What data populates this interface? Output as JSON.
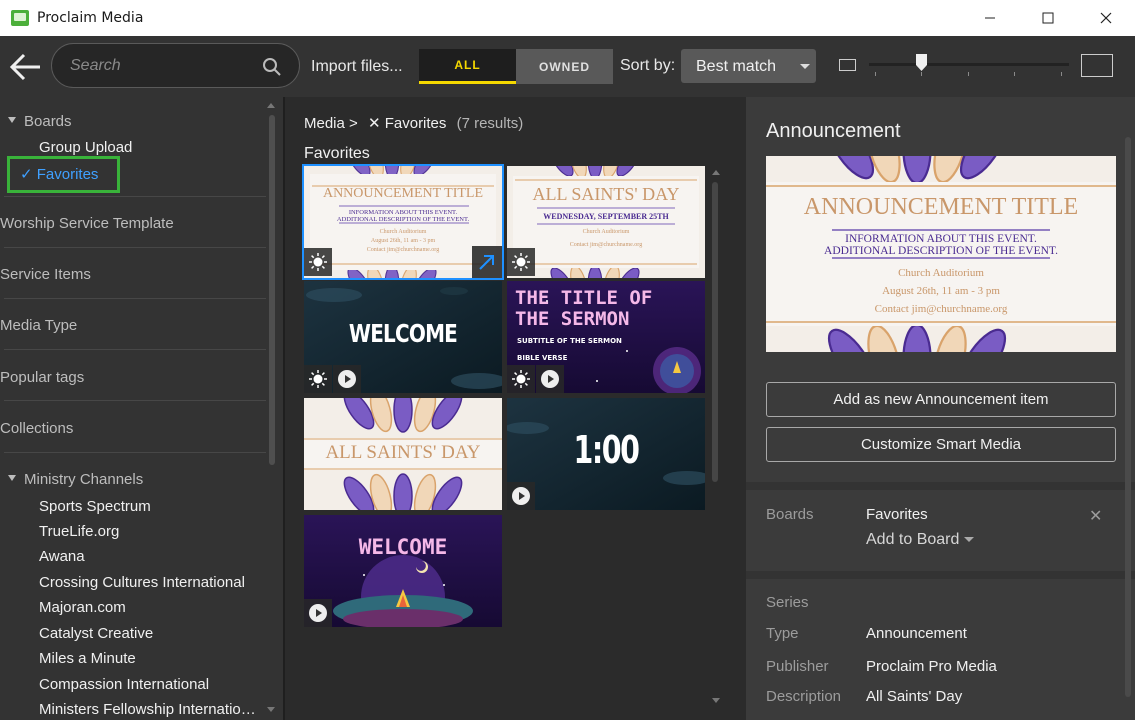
{
  "window": {
    "title": "Proclaim Media",
    "minimize": "—",
    "maximize": "☐",
    "close": "✕"
  },
  "toolbar": {
    "search_placeholder": "Search",
    "import_label": "Import files...",
    "filter_all": "ALL",
    "filter_owned": "OWNED",
    "sort_label": "Sort by:",
    "sort_value": "Best match",
    "zoom_level": 0.26
  },
  "sidebar": {
    "sections": [
      {
        "label": "Boards",
        "expanded": true
      },
      {
        "label": "Worship Service Template",
        "expanded": false
      },
      {
        "label": "Service Items",
        "expanded": false
      },
      {
        "label": "Media Type",
        "expanded": false
      },
      {
        "label": "Popular tags",
        "expanded": false
      },
      {
        "label": "Collections",
        "expanded": false
      },
      {
        "label": "Ministry Channels",
        "expanded": true
      }
    ],
    "boards": {
      "group_upload": "Group Upload",
      "favorites": "✓ Favorites"
    },
    "channels": [
      "Sports Spectrum",
      "TrueLife.org",
      "Awana",
      "Crossing Cultures International",
      "Majoran.com",
      "Catalyst Creative",
      "Miles a Minute",
      "Compassion International",
      "Ministers Fellowship Internatio…"
    ]
  },
  "middle": {
    "breadcrumb_root": "Media",
    "breadcrumb_sep": ">",
    "breadcrumb_filter_x": "✕",
    "breadcrumb_filter": "Favorites",
    "result_count": "(7 results)",
    "section_title": "Favorites",
    "tiles": {
      "t1": {
        "title": "ANNOUNCEMENT TITLE",
        "line1": "INFORMATION ABOUT THIS EVENT.",
        "line2": "ADDITIONAL DESCRIPTION OF THE EVENT.",
        "loc": "Church Auditorium",
        "date": "August 26th, 11 am - 3 pm",
        "contact": "Contact jim@churchname.org"
      },
      "t2": {
        "title": "ALL SAINTS' DAY",
        "date": "WEDNESDAY, SEPTEMBER 25TH",
        "loc": "Church Auditorium",
        "contact": "Contact jim@churchname.org"
      },
      "t3": {
        "title": "WELCOME"
      },
      "t4": {
        "title1": "THE TITLE OF",
        "title2": "THE SERMON",
        "sub": "SUBTITLE OF THE SERMON",
        "verse": "BIBLE VERSE"
      },
      "t5": {
        "title": "ALL SAINTS' DAY"
      },
      "t6": {
        "title": "1:00"
      },
      "t7": {
        "title": "WELCOME"
      }
    }
  },
  "details": {
    "title": "Announcement",
    "preview": {
      "title": "ANNOUNCEMENT TITLE",
      "line1": "INFORMATION ABOUT THIS EVENT.",
      "line2": "ADDITIONAL DESCRIPTION OF THE EVENT.",
      "loc": "Church Auditorium",
      "date": "August 26th, 11 am - 3 pm",
      "contact": "Contact jim@churchname.org"
    },
    "btn_add": "Add as new Announcement item",
    "btn_customize": "Customize Smart Media",
    "boards_label": "Boards",
    "boards_value": "Favorites",
    "boards_remove": "✕",
    "add_to_board": "Add to Board",
    "series_label": "Series",
    "type_label": "Type",
    "type_value": "Announcement",
    "publisher_label": "Publisher",
    "publisher_value": "Proclaim Pro Media",
    "description_label": "Description",
    "description_value": "All Saints' Day"
  },
  "colors": {
    "accent_yellow": "#f5d800",
    "selected_blue": "#1e90ff",
    "favorites_green": "#39b33a",
    "link_blue": "#3fa0ff"
  }
}
